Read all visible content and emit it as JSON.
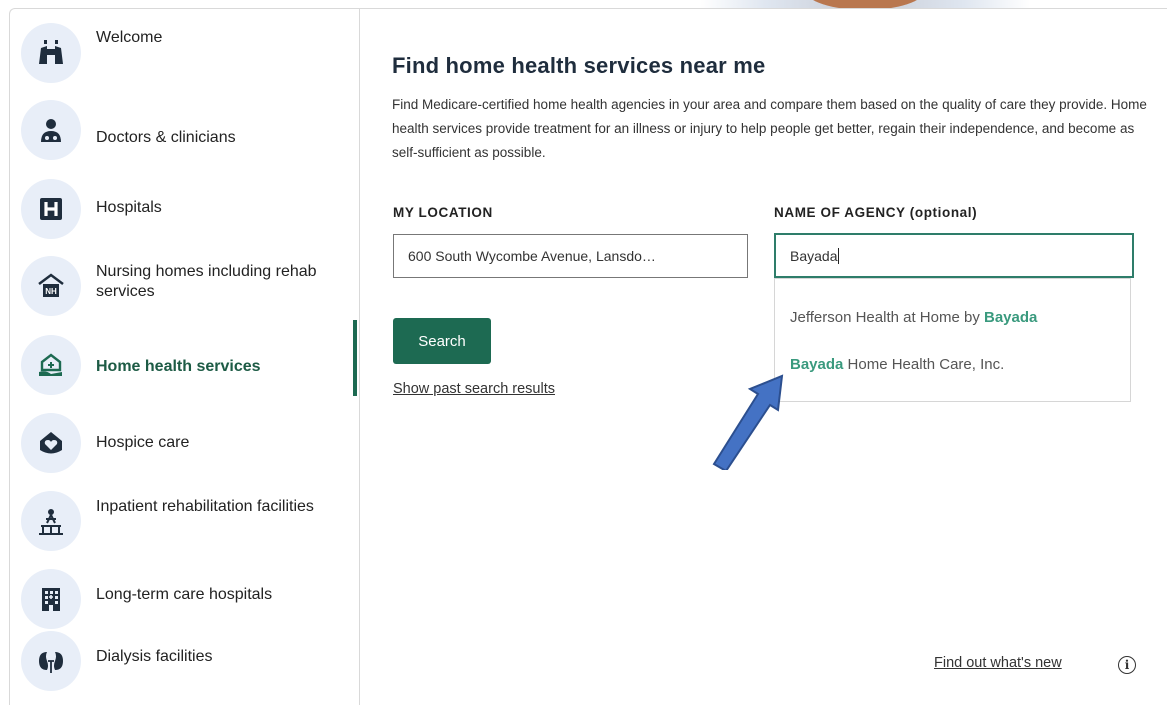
{
  "sidebar": {
    "items": [
      {
        "label": "Welcome",
        "icon": "binoculars-icon"
      },
      {
        "label": "Doctors & clinicians",
        "icon": "doctor-icon"
      },
      {
        "label": "Hospitals",
        "icon": "hospital-h-icon"
      },
      {
        "label": "Nursing homes including rehab services",
        "icon": "nursing-home-icon"
      },
      {
        "label": "Home health services",
        "icon": "home-health-icon"
      },
      {
        "label": "Hospice care",
        "icon": "hospice-heart-icon"
      },
      {
        "label": "Inpatient rehabilitation facilities",
        "icon": "rehab-facility-icon"
      },
      {
        "label": "Long-term care hospitals",
        "icon": "building-icon"
      },
      {
        "label": "Dialysis facilities",
        "icon": "kidney-icon"
      }
    ],
    "active_index": 4
  },
  "main": {
    "title": "Find home health services near me",
    "description": "Find Medicare-certified home health agencies in your area and compare them based on the quality of care they provide. Home health services provide treatment for an illness or injury to help people get better, regain their independence, and become as self-sufficient as possible.",
    "location_label": "MY LOCATION",
    "location_value": "600 South Wycombe Avenue, Lansdo…",
    "agency_label": "NAME OF AGENCY (optional)",
    "agency_value": "Bayada",
    "suggestions": [
      {
        "prefix": "Jefferson Health at Home by ",
        "match": "Bayada",
        "suffix": ""
      },
      {
        "prefix": "",
        "match": "Bayada",
        "suffix": " Home Health Care, Inc."
      }
    ],
    "search_label": "Search",
    "past_results_link": "Show past search results",
    "whats_new_link": "Find out what's new",
    "info_glyph": "i"
  },
  "colors": {
    "accent": "#1d6a52",
    "match_highlight": "#3a9a7e",
    "icon_circle": "#e8eef8",
    "arrow": "#3f6fb5"
  }
}
